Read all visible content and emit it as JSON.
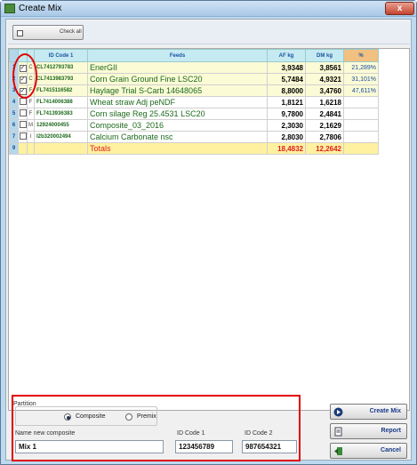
{
  "window": {
    "title": "Create Mix",
    "close": "x"
  },
  "toolbar": {
    "check_all": "Check all"
  },
  "grid": {
    "headers": {
      "code": "ID Code 1",
      "feeds": "Feeds",
      "af": "AF kg",
      "dm": "DM kg",
      "pct": "%"
    },
    "rows": [
      {
        "n": "1",
        "checked": "✓",
        "type": "C",
        "code": "CL7412793783",
        "feed": "EnerGII",
        "af": "3,9348",
        "dm": "3,8561",
        "pct": "21,289%"
      },
      {
        "n": "2",
        "checked": "✓",
        "type": "C",
        "code": "CL7413983793",
        "feed": "Corn Grain Ground Fine LSC20",
        "af": "5,7484",
        "dm": "4,9321",
        "pct": "31,101%"
      },
      {
        "n": "3",
        "checked": "✓",
        "type": "F",
        "code": "FL7415116582",
        "feed": "Haylage Trial S-Carb 14648065",
        "af": "8,8000",
        "dm": "3,4760",
        "pct": "47,611%"
      },
      {
        "n": "4",
        "checked": "",
        "type": "F",
        "code": "FL7414006388",
        "feed": "Wheat straw Adj peNDF",
        "af": "1,8121",
        "dm": "1,6218",
        "pct": ""
      },
      {
        "n": "5",
        "checked": "",
        "type": "F",
        "code": "FL7413936383",
        "feed": "Corn silage Reg 25.4531 LSC20",
        "af": "9,7800",
        "dm": "2,4841",
        "pct": ""
      },
      {
        "n": "6",
        "checked": "",
        "type": "M",
        "code": "12924000455",
        "feed": "Composite_03_2016",
        "af": "2,3030",
        "dm": "2,1629",
        "pct": ""
      },
      {
        "n": "7",
        "checked": "",
        "type": "I",
        "code": "I2b320002494",
        "feed": "Calcium Carbonate nsc",
        "af": "2,8030",
        "dm": "2,7806",
        "pct": ""
      }
    ],
    "totals": {
      "n": "9",
      "label": "Totals",
      "af": "18,4832",
      "dm": "12,2642"
    }
  },
  "partition": {
    "title": "Partition",
    "composite": "Composite",
    "premix": "Premix",
    "selected": "Composite"
  },
  "form": {
    "name_label": "Name new composite",
    "name_value": "Mix 1",
    "id1_label": "ID Code 1",
    "id1_value": "123456789",
    "id2_label": "ID Code 2",
    "id2_value": "987654321"
  },
  "buttons": {
    "create": "Create Mix",
    "report": "Report",
    "cancel": "Cancel"
  },
  "colors": {
    "accent": "#1a3a8a",
    "highlight": "#e00000",
    "total_row": "#fff1a0"
  }
}
